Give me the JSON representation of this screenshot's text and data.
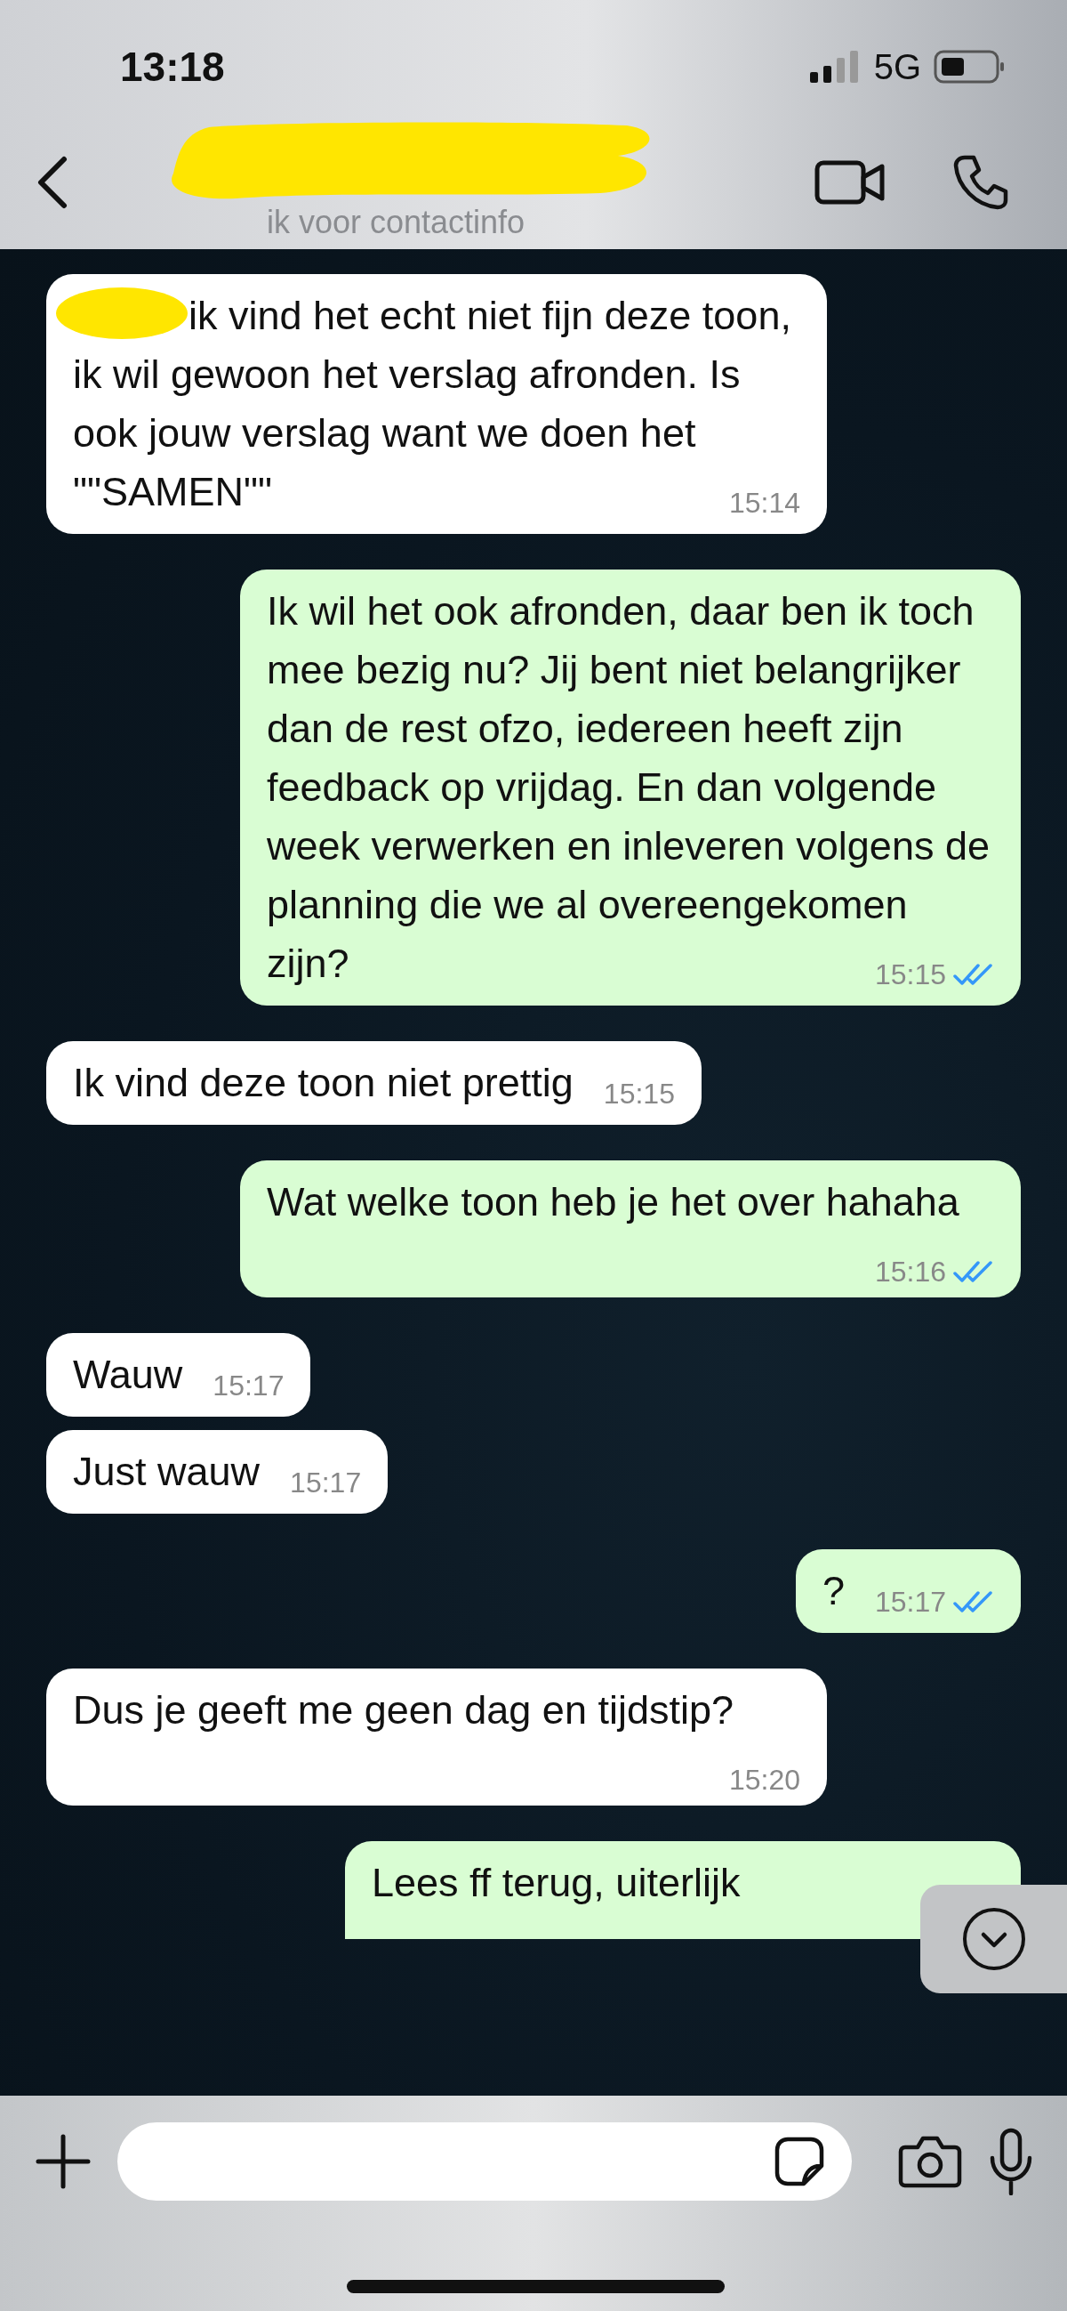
{
  "status_bar": {
    "time": "13:18",
    "network": "5G"
  },
  "header": {
    "name_redacted": true,
    "subtitle": "ik voor contactinfo"
  },
  "messages": [
    {
      "kind": "incoming",
      "redacted_start": true,
      "text": "ik vind het echt niet fijn deze toon, ik wil gewoon het verslag afronden. Is ook jouw verslag want we doen het \"\"SAMEN\"\"",
      "time": "15:14"
    },
    {
      "kind": "outgoing",
      "text": "Ik wil het ook afronden, daar ben ik toch mee bezig nu? Jij bent niet belangrijker dan de rest ofzo, iedereen heeft zijn feedback op vrijdag. En dan volgende week verwerken en inleveren volgens de planning die we al overeengekomen zijn?",
      "time": "15:15",
      "read": true
    },
    {
      "kind": "incoming",
      "text": "Ik vind deze toon niet prettig",
      "time": "15:15"
    },
    {
      "kind": "outgoing",
      "text": "Wat welke toon heb je het over hahaha",
      "time": "15:16",
      "read": true
    },
    {
      "kind": "incoming",
      "text": "Wauw",
      "time": "15:17"
    },
    {
      "kind": "incoming",
      "text": "Just wauw",
      "time": "15:17"
    },
    {
      "kind": "outgoing",
      "text": "?",
      "time": "15:17",
      "read": true
    },
    {
      "kind": "incoming",
      "text": "Dus je geeft me geen dag en tijdstip?",
      "time": "15:20"
    },
    {
      "kind": "outgoing",
      "text": "Lees ff terug, uiterlijk",
      "cut": true
    }
  ]
}
